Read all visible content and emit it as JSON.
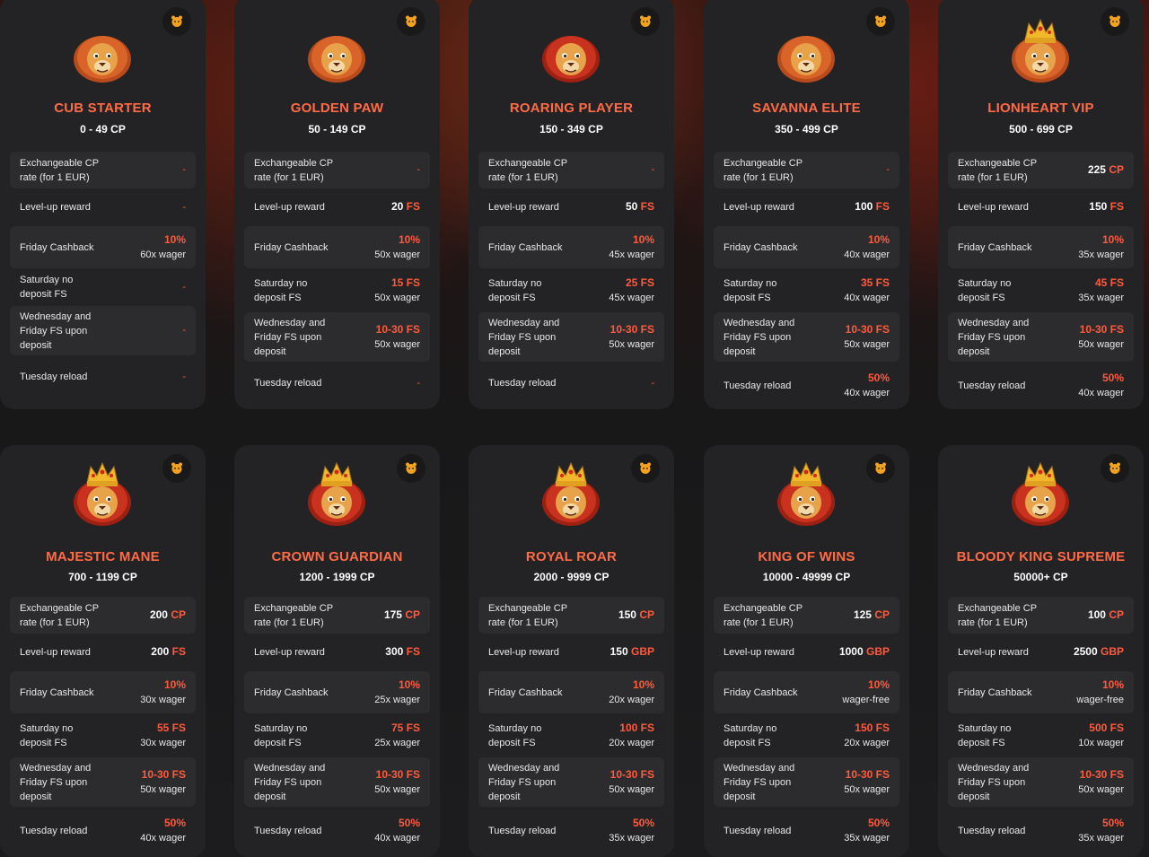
{
  "labels": {
    "exchange": "Exchangeable CP rate (for 1 EUR)",
    "levelup": "Level-up reward",
    "friday": "Friday Cashback",
    "saturday": "Saturday no deposit FS",
    "wedfri": "Wednesday and Friday FS upon deposit",
    "tuesday": "Tuesday reload"
  },
  "colors": {
    "accent": "#ff5a3c",
    "title": "#ff6b45",
    "card": "#232325",
    "row": "#2c2c2f"
  },
  "tiers": [
    {
      "name": "CUB STARTER",
      "range": "0 - 49 CP",
      "icon": "lion-cub-icon",
      "exchange": {
        "dash": "-"
      },
      "levelup": {
        "dash": "-"
      },
      "friday": {
        "pct": "10%",
        "sub": "60x wager"
      },
      "saturday": {
        "dash": "-"
      },
      "wedfri": {
        "dash": "-"
      },
      "tuesday": {
        "dash": "-"
      }
    },
    {
      "name": "GOLDEN PAW",
      "range": "50 - 149 CP",
      "icon": "paw-icon",
      "exchange": {
        "dash": "-"
      },
      "levelup": {
        "num": "20",
        "unit": "FS"
      },
      "friday": {
        "pct": "10%",
        "sub": "50x wager"
      },
      "saturday": {
        "pct": "15 FS",
        "sub": "50x wager"
      },
      "wedfri": {
        "pct": "10-30 FS",
        "sub": "50x wager"
      },
      "tuesday": {
        "dash": "-"
      }
    },
    {
      "name": "ROARING PLAYER",
      "range": "150 - 349 CP",
      "icon": "lion-head-icon",
      "exchange": {
        "dash": "-"
      },
      "levelup": {
        "num": "50",
        "unit": "FS"
      },
      "friday": {
        "pct": "10%",
        "sub": "45x wager"
      },
      "saturday": {
        "pct": "25 FS",
        "sub": "45x wager"
      },
      "wedfri": {
        "pct": "10-30 FS",
        "sub": "50x wager"
      },
      "tuesday": {
        "dash": "-"
      }
    },
    {
      "name": "SAVANNA ELITE",
      "range": "350 - 499 CP",
      "icon": "savanna-icon",
      "exchange": {
        "dash": "-"
      },
      "levelup": {
        "num": "100",
        "unit": "FS"
      },
      "friday": {
        "pct": "10%",
        "sub": "40x wager"
      },
      "saturday": {
        "pct": "35 FS",
        "sub": "40x wager"
      },
      "wedfri": {
        "pct": "10-30 FS",
        "sub": "50x wager"
      },
      "tuesday": {
        "pct": "50%",
        "sub": "40x wager"
      }
    },
    {
      "name": "LIONHEART VIP",
      "range": "500 - 699 CP",
      "icon": "shield-icon",
      "exchange": {
        "num": "225",
        "unit": "CP"
      },
      "levelup": {
        "num": "150",
        "unit": "FS"
      },
      "friday": {
        "pct": "10%",
        "sub": "35x wager"
      },
      "saturday": {
        "pct": "45 FS",
        "sub": "35x wager"
      },
      "wedfri": {
        "pct": "10-30 FS",
        "sub": "50x wager"
      },
      "tuesday": {
        "pct": "50%",
        "sub": "40x wager"
      }
    },
    {
      "name": "MAJESTIC MANE",
      "range": "700 - 1199 CP",
      "icon": "lion-medal-icon",
      "exchange": {
        "num": "200",
        "unit": "CP"
      },
      "levelup": {
        "num": "200",
        "unit": "FS"
      },
      "friday": {
        "pct": "10%",
        "sub": "30x wager"
      },
      "saturday": {
        "pct": "55 FS",
        "sub": "30x wager"
      },
      "wedfri": {
        "pct": "10-30 FS",
        "sub": "50x wager"
      },
      "tuesday": {
        "pct": "50%",
        "sub": "40x wager"
      }
    },
    {
      "name": "CROWN GUARDIAN",
      "range": "1200 - 1999 CP",
      "icon": "lion-profile-icon",
      "exchange": {
        "num": "175",
        "unit": "CP"
      },
      "levelup": {
        "num": "300",
        "unit": "FS"
      },
      "friday": {
        "pct": "10%",
        "sub": "25x wager"
      },
      "saturday": {
        "pct": "75 FS",
        "sub": "25x wager"
      },
      "wedfri": {
        "pct": "10-30 FS",
        "sub": "50x wager"
      },
      "tuesday": {
        "pct": "50%",
        "sub": "40x wager"
      }
    },
    {
      "name": "ROYAL ROAR",
      "range": "2000 - 9999 CP",
      "icon": "lion-profile-icon",
      "exchange": {
        "num": "150",
        "unit": "CP"
      },
      "levelup": {
        "num": "150",
        "unit": "GBP"
      },
      "friday": {
        "pct": "10%",
        "sub": "20x wager"
      },
      "saturday": {
        "pct": "100 FS",
        "sub": "20x wager"
      },
      "wedfri": {
        "pct": "10-30 FS",
        "sub": "50x wager"
      },
      "tuesday": {
        "pct": "50%",
        "sub": "35x wager"
      }
    },
    {
      "name": "KING OF WINS",
      "range": "10000 - 49999 CP",
      "icon": "crown-emblem-icon",
      "exchange": {
        "num": "125",
        "unit": "CP"
      },
      "levelup": {
        "num": "1000",
        "unit": "GBP"
      },
      "friday": {
        "pct": "10%",
        "sub": "wager-free"
      },
      "saturday": {
        "pct": "150 FS",
        "sub": "20x wager"
      },
      "wedfri": {
        "pct": "10-30 FS",
        "sub": "50x wager"
      },
      "tuesday": {
        "pct": "50%",
        "sub": "35x wager"
      }
    },
    {
      "name": "BLOODY KING SUPREME",
      "range": "50000+ CP",
      "icon": "lion-shield-icon",
      "exchange": {
        "num": "100",
        "unit": "CP"
      },
      "levelup": {
        "num": "2500",
        "unit": "GBP"
      },
      "friday": {
        "pct": "10%",
        "sub": "wager-free"
      },
      "saturday": {
        "pct": "500 FS",
        "sub": "10x wager"
      },
      "wedfri": {
        "pct": "10-30 FS",
        "sub": "50x wager"
      },
      "tuesday": {
        "pct": "50%",
        "sub": "35x wager"
      }
    }
  ]
}
